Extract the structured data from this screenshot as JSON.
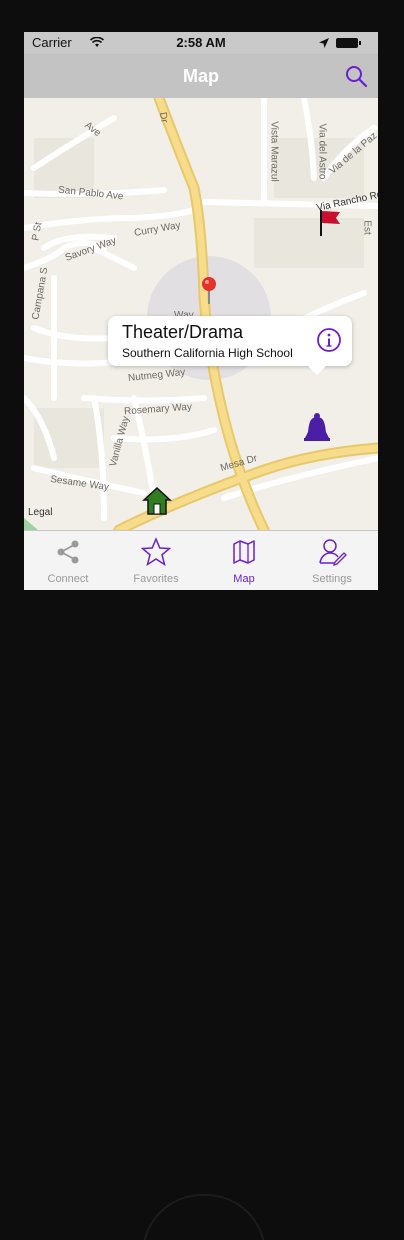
{
  "status_bar": {
    "carrier": "Carrier",
    "time": "2:58 AM",
    "wifi_icon": "wifi-icon",
    "location_icon": "location-arrow-icon",
    "battery_icon": "battery-icon"
  },
  "nav": {
    "title": "Map",
    "search_icon": "search-icon"
  },
  "map": {
    "streets": [
      "Ave",
      "Dr",
      "Vista Marazul",
      "Via del Astro",
      "Via de la Paz",
      "San Pablo Ave",
      "Via Rancho Rd",
      "Savory Way",
      "Curry Way",
      "Way",
      "Nutmeg Way",
      "Rosemary Way",
      "Vanilla Way",
      "Sesame Way",
      "Mesa Dr",
      "Est",
      "P St",
      "Campana S"
    ],
    "legal": "Legal",
    "markers": [
      "flag-marker-icon",
      "bell-marker-icon",
      "home-marker-icon",
      "red-pin-icon",
      "user-location-icon"
    ]
  },
  "callout": {
    "title": "Theater/Drama",
    "subtitle": "Southern California High School",
    "info_icon": "info-icon"
  },
  "tabs": [
    {
      "label": "Connect",
      "icon": "share-icon",
      "active": false
    },
    {
      "label": "Favorites",
      "icon": "star-icon",
      "active": false
    },
    {
      "label": "Map",
      "icon": "map-icon",
      "active": true
    },
    {
      "label": "Settings",
      "icon": "user-settings-icon",
      "active": false
    }
  ],
  "colors": {
    "accent": "#6a1fd1",
    "navbar": "#c3c3c3",
    "map_background": "#f3f1ea",
    "major_road": "#f4d78a",
    "flag": "#c8102e",
    "home": "#2f7d1e"
  }
}
